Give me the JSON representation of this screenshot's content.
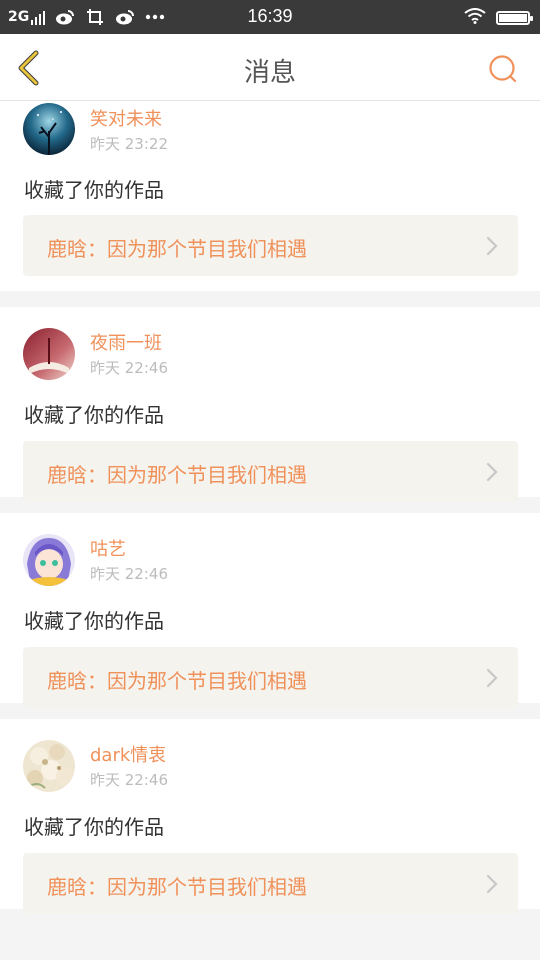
{
  "status_bar": {
    "network": "2G",
    "time": "16:39",
    "icons": [
      "signal-icon",
      "weibo-icon",
      "crop-icon",
      "weibo-icon",
      "more-dots-icon",
      "wifi-icon",
      "battery-icon"
    ],
    "battery_level": 1.0
  },
  "header": {
    "title": "消息",
    "back_icon": "chevron-left-icon",
    "search_icon": "search-icon",
    "accent": "#f0915a"
  },
  "messages": [
    {
      "name": "笑对未来",
      "time": "昨天 23:22",
      "action": "收藏了你的作品",
      "quote": "鹿晗：因为那个节目我们相遇",
      "avatar": "avatar-night-tree"
    },
    {
      "name": "夜雨一班",
      "time": "昨天 22:46",
      "action": "收藏了你的作品",
      "quote": "鹿晗：因为那个节目我们相遇",
      "avatar": "avatar-book-rose"
    },
    {
      "name": "咕艺",
      "time": "昨天 22:46",
      "action": "收藏了你的作品",
      "quote": "鹿晗：因为那个节目我们相遇",
      "avatar": "avatar-anime-girl"
    },
    {
      "name": "dark情衷",
      "time": "昨天 22:46",
      "action": "收藏了你的作品",
      "quote": "鹿晗：因为那个节目我们相遇",
      "avatar": "avatar-flowers"
    }
  ]
}
